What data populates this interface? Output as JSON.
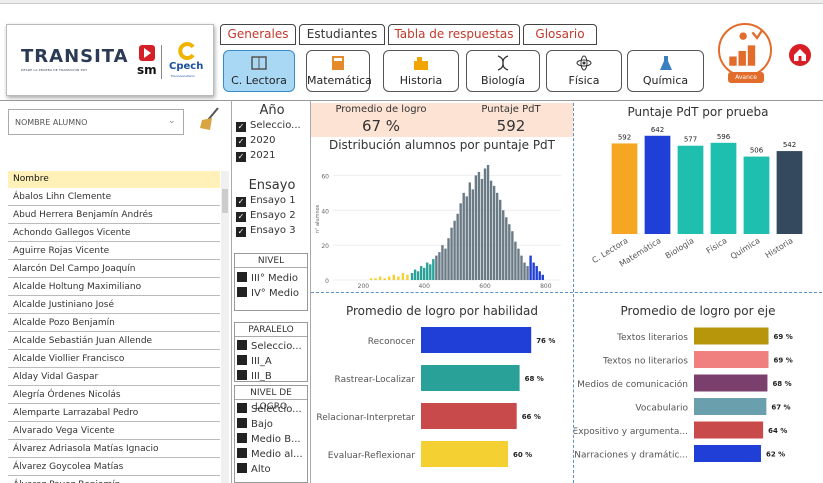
{
  "header": {
    "logo_main": "TRANSITA",
    "logo_sub": "DESDE LA PRUEBA DE TRANSICIÓN PDT",
    "sm_label": "sm",
    "cpech_label": "Cpech",
    "cpech_sub": "Preuniversitario",
    "avance_label": "Avance",
    "tabs": [
      {
        "label": "Generales",
        "color": "#c0392b"
      },
      {
        "label": "Estudiantes",
        "color": "#222222"
      },
      {
        "label": "Tabla de respuestas",
        "color": "#c0392b"
      },
      {
        "label": "Glosario",
        "color": "#c0392b"
      }
    ],
    "subjects": [
      {
        "label": "C. Lectora",
        "icon": "book-icon",
        "active": true
      },
      {
        "label": "Matemática",
        "icon": "calculator-icon",
        "active": false
      },
      {
        "label": "Historia",
        "icon": "city-icon",
        "active": false
      },
      {
        "label": "Biología",
        "icon": "dna-icon",
        "active": false
      },
      {
        "label": "Física",
        "icon": "atom-icon",
        "active": false
      },
      {
        "label": "Química",
        "icon": "flask-icon",
        "active": false
      }
    ]
  },
  "student_filter": {
    "placeholder": "NOMBRE ALUMNO"
  },
  "students": {
    "header": "Nombre",
    "rows": [
      "Ábalos Lihn Clemente",
      "Abud Herrera Benjamín Andrés",
      "Achondo Gallegos Vicente",
      "Aguirre Rojas Vicente",
      "Alarcón Del Campo Joaquín",
      "Alcalde Holtung Maximiliano",
      "Alcalde Justiniano José",
      "Alcalde Pozo Benjamín",
      "Alcalde Sebastián Juan Allende",
      "Alcalde Viollier Francisco",
      "Alday Vidal Gaspar",
      "Alegría Órdenes Nicolás",
      "Alemparte Larrazabal Pedro",
      "Alvarado Vega Vicente",
      "Álvarez Adriasola Matías Ignacio",
      "Álvarez Goycolea Matías",
      "Álvarez Pavez Benjamín"
    ]
  },
  "filters": {
    "anio": {
      "title": "Año",
      "items": [
        "Seleccio...",
        "2020",
        "2021"
      ]
    },
    "ensayo": {
      "title": "Ensayo",
      "items": [
        "Ensayo 1",
        "Ensayo 2",
        "Ensayo 3"
      ]
    },
    "nivel": {
      "title": "NIVEL",
      "items": [
        "III° Medio",
        "IV° Medio"
      ]
    },
    "paralelo": {
      "title": "PARALELO",
      "items": [
        "Seleccio...",
        "III_A",
        "III_B"
      ]
    },
    "nivel_logro": {
      "title": "NIVEL DE LOGRO",
      "items": [
        "Seleccio...",
        "Bajo",
        "Medio B...",
        "Medio al...",
        "Alto"
      ]
    }
  },
  "kpis": {
    "logro_label": "Promedio de logro",
    "logro_value": "67 %",
    "pdt_label": "Puntaje PdT",
    "pdt_value": "592"
  },
  "colors": {
    "yellow": "#f5d033",
    "teal": "#2aa198",
    "gray": "#6b7b86",
    "blue": "#1f3fd6",
    "orange": "#f5a623",
    "red": "#c94a4a"
  },
  "chart_data": [
    {
      "type": "bar",
      "title": "Distribución alumnos por puntaje PdT",
      "xlabel": "",
      "ylabel": "n° alumnos",
      "xlim": [
        100,
        850
      ],
      "ylim": [
        0,
        70
      ],
      "xticks": [
        200,
        400,
        600,
        800
      ],
      "yticks": [
        0,
        20,
        40,
        60
      ],
      "series": [
        {
          "name": "",
          "color": "#f5d033",
          "x": [
            225,
            240,
            255,
            270,
            285,
            300,
            315,
            330,
            345
          ],
          "values": [
            1,
            1,
            2,
            1,
            2,
            3,
            2,
            4,
            3
          ]
        },
        {
          "name": "",
          "color": "#2aa198",
          "x": [
            360,
            370,
            380,
            390,
            400,
            410,
            420,
            430
          ],
          "values": [
            4,
            6,
            5,
            8,
            7,
            10,
            9,
            12
          ]
        },
        {
          "name": "",
          "color": "#6b7b86",
          "x": [
            440,
            450,
            460,
            470,
            480,
            490,
            500,
            510,
            520,
            530,
            540,
            550,
            560,
            570,
            580,
            590,
            600,
            610,
            620,
            630,
            640,
            650,
            660,
            670,
            680,
            690,
            700,
            710,
            720,
            730,
            740
          ],
          "values": [
            14,
            16,
            20,
            18,
            24,
            30,
            34,
            38,
            44,
            50,
            48,
            56,
            52,
            60,
            62,
            58,
            64,
            66,
            57,
            54,
            50,
            46,
            40,
            36,
            32,
            28,
            22,
            18,
            14,
            10,
            8
          ]
        },
        {
          "name": "",
          "color": "#1f3fd6",
          "x": [
            750,
            760,
            770,
            780,
            790
          ],
          "values": [
            14,
            10,
            8,
            5,
            3
          ]
        }
      ]
    },
    {
      "type": "bar",
      "title": "Puntaje PdT por prueba",
      "categories": [
        "C. Lectora",
        "Matemática",
        "Biología",
        "Física",
        "Química",
        "Historia"
      ],
      "values": [
        592,
        642,
        577,
        596,
        506,
        542
      ],
      "colors": [
        "#f5a623",
        "#1f3fd6",
        "#1fbfb0",
        "#1fbfb0",
        "#1fbfb0",
        "#34495e"
      ],
      "ylim": [
        0,
        700
      ]
    },
    {
      "type": "bar",
      "orientation": "horizontal",
      "title": "Promedio de logro por habilidad",
      "categories": [
        "Reconocer",
        "Rastrear-Localizar",
        "Relacionar-Interpretar",
        "Evaluar-Reflexionar"
      ],
      "values": [
        76,
        68,
        66,
        60
      ],
      "colors": [
        "#1f3fd6",
        "#2aa198",
        "#c94a4a",
        "#f5d033"
      ],
      "xlim": [
        0,
        100
      ]
    },
    {
      "type": "bar",
      "orientation": "horizontal",
      "title": "Promedio de logro por eje",
      "categories": [
        "Textos literarios",
        "Textos no literarios",
        "Medios de comunicación",
        "Vocabulario",
        "Expositivo y argumenta...",
        "Narraciones y dramátic..."
      ],
      "values": [
        69,
        69,
        68,
        67,
        64,
        62
      ],
      "colors": [
        "#b8960c",
        "#f08080",
        "#7b3f6e",
        "#6aa0ae",
        "#c94a4a",
        "#1f3fd6"
      ],
      "xlim": [
        0,
        100
      ]
    }
  ]
}
